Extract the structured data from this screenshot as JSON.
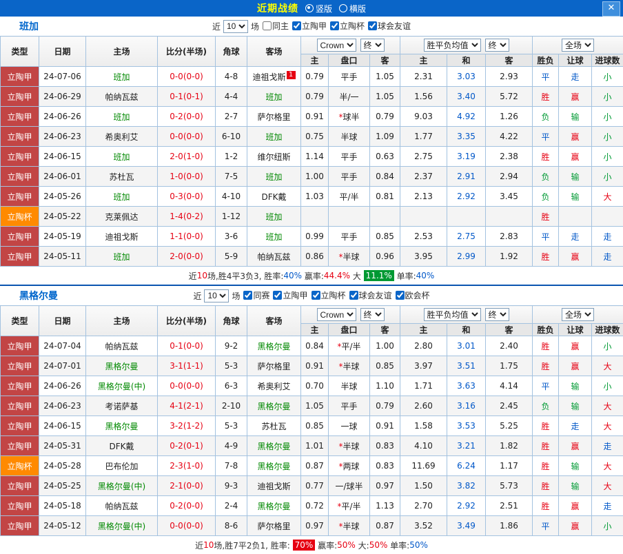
{
  "topbar": {
    "title": "近期战绩",
    "vertical_label": "竖版",
    "horizontal_label": "横版",
    "close": "✕"
  },
  "colors": {
    "red": "#e60012",
    "green": "#009933",
    "blue": "#0057c8",
    "league_red": "#c24545",
    "league_orange": "#ff8a00",
    "topbar_blue": "#0a65c8",
    "team_green": "#008800",
    "title_yellow": "#ffff00",
    "link_blue": "#0066cc"
  },
  "table_header": {
    "type": "类型",
    "date": "日期",
    "home": "主场",
    "score": "比分(半场)",
    "corner": "角球",
    "away": "客场",
    "odds_source": "Crown",
    "final": "终",
    "avg_label": "胜平负均值",
    "final2": "终",
    "scope": "全场",
    "home_odds": "主",
    "handicap": "盘口",
    "away_odds": "客",
    "home_eu": "主",
    "draw_eu": "和",
    "away_eu": "客",
    "result": "胜负",
    "handicap_result": "让球",
    "goals": "进球数"
  },
  "sections": [
    {
      "team": "班加",
      "filter": {
        "prefix": "近",
        "count": "10",
        "suffix": "场",
        "options": [
          {
            "label": "同主",
            "checked": false
          },
          {
            "label": "立陶甲",
            "checked": true
          },
          {
            "label": "立陶杯",
            "checked": true
          },
          {
            "label": "球会友谊",
            "checked": true
          }
        ]
      },
      "rows": [
        {
          "league": "立陶甲",
          "date": "24-07-06",
          "home": "班加",
          "home_team": true,
          "score": "0-0(0-0)",
          "corner": "4-8",
          "away": "迪祖戈斯",
          "badge": "1",
          "ah": "0.79",
          "hcap": "平手",
          "aa": "1.05",
          "eh": "2.31",
          "ed": "3.03",
          "ea": "2.93",
          "res": "平",
          "res_c": "blue",
          "let": "走",
          "let_c": "blue",
          "goal": "小",
          "goal_c": "green"
        },
        {
          "league": "立陶甲",
          "date": "24-06-29",
          "home": "帕纳瓦兹",
          "score": "0-1(0-1)",
          "corner": "4-4",
          "away": "班加",
          "away_team": true,
          "ah": "0.79",
          "hcap": "半/一",
          "aa": "1.05",
          "eh": "1.56",
          "ed": "3.40",
          "ea": "5.72",
          "res": "胜",
          "res_c": "red",
          "let": "赢",
          "let_c": "red",
          "goal": "小",
          "goal_c": "green"
        },
        {
          "league": "立陶甲",
          "date": "24-06-26",
          "home": "班加",
          "home_team": true,
          "score": "0-2(0-0)",
          "corner": "2-7",
          "away": "萨尔格里",
          "ah": "0.91",
          "hcap": "*球半",
          "aa": "0.79",
          "eh": "9.03",
          "ed": "4.92",
          "ea": "1.26",
          "res": "负",
          "res_c": "green",
          "let": "输",
          "let_c": "green",
          "goal": "小",
          "goal_c": "green"
        },
        {
          "league": "立陶甲",
          "date": "24-06-23",
          "home": "希奥利艾",
          "score": "0-0(0-0)",
          "corner": "6-10",
          "away": "班加",
          "away_team": true,
          "ah": "0.75",
          "hcap": "半球",
          "aa": "1.09",
          "eh": "1.77",
          "ed": "3.35",
          "ea": "4.22",
          "res": "平",
          "res_c": "blue",
          "let": "赢",
          "let_c": "red",
          "goal": "小",
          "goal_c": "green"
        },
        {
          "league": "立陶甲",
          "date": "24-06-15",
          "home": "班加",
          "home_team": true,
          "score": "2-0(1-0)",
          "corner": "1-2",
          "away": "维尔纽斯",
          "ah": "1.14",
          "hcap": "平手",
          "aa": "0.63",
          "eh": "2.75",
          "ed": "3.19",
          "ea": "2.38",
          "res": "胜",
          "res_c": "red",
          "let": "赢",
          "let_c": "red",
          "goal": "小",
          "goal_c": "green"
        },
        {
          "league": "立陶甲",
          "date": "24-06-01",
          "home": "苏杜瓦",
          "score": "1-0(0-0)",
          "corner": "7-5",
          "away": "班加",
          "away_team": true,
          "ah": "1.00",
          "hcap": "平手",
          "aa": "0.84",
          "eh": "2.37",
          "ed": "2.91",
          "ea": "2.94",
          "res": "负",
          "res_c": "green",
          "let": "输",
          "let_c": "green",
          "goal": "小",
          "goal_c": "green"
        },
        {
          "league": "立陶甲",
          "date": "24-05-26",
          "home": "班加",
          "home_team": true,
          "score": "0-3(0-0)",
          "corner": "4-10",
          "away": "DFK戴",
          "ah": "1.03",
          "hcap": "平/半",
          "aa": "0.81",
          "eh": "2.13",
          "ed": "2.92",
          "ea": "3.45",
          "res": "负",
          "res_c": "green",
          "let": "输",
          "let_c": "green",
          "goal": "大",
          "goal_c": "red"
        },
        {
          "league": "立陶杯",
          "league_color": "orange",
          "date": "24-05-22",
          "home": "克莱佩达",
          "score": "1-4(0-2)",
          "corner": "1-12",
          "away": "班加",
          "away_team": true,
          "ah": "",
          "hcap": "",
          "aa": "",
          "eh": "",
          "ed": "",
          "ea": "",
          "res": "胜",
          "res_c": "red",
          "let": "",
          "goal": ""
        },
        {
          "league": "立陶甲",
          "date": "24-05-19",
          "home": "迪祖戈斯",
          "score": "1-1(0-0)",
          "corner": "3-6",
          "away": "班加",
          "away_team": true,
          "ah": "0.99",
          "hcap": "平手",
          "aa": "0.85",
          "eh": "2.53",
          "ed": "2.75",
          "ea": "2.83",
          "res": "平",
          "res_c": "blue",
          "let": "走",
          "let_c": "blue",
          "goal": "走",
          "goal_c": "blue"
        },
        {
          "league": "立陶甲",
          "date": "24-05-11",
          "home": "班加",
          "home_team": true,
          "score": "2-0(0-0)",
          "corner": "5-9",
          "away": "帕纳瓦兹",
          "ah": "0.86",
          "hcap": "*半球",
          "aa": "0.96",
          "eh": "3.95",
          "ed": "2.99",
          "ea": "1.92",
          "res": "胜",
          "res_c": "red",
          "let": "赢",
          "let_c": "red",
          "goal": "走",
          "goal_c": "blue"
        }
      ],
      "summary": [
        {
          "t": "近"
        },
        {
          "t": "10",
          "c": "red"
        },
        {
          "t": "场,胜4平3负3, 胜率:"
        },
        {
          "t": "40%",
          "c": "blue"
        },
        {
          "t": " 赢率:"
        },
        {
          "t": "44.4%",
          "c": "red"
        },
        {
          "t": " 大 "
        },
        {
          "t": "11.1%",
          "bg": "green"
        },
        {
          "t": " 单率:"
        },
        {
          "t": "40%",
          "c": "blue"
        }
      ]
    },
    {
      "team": "黑格尔曼",
      "filter": {
        "prefix": "近",
        "count": "10",
        "suffix": "场",
        "options": [
          {
            "label": "同赛",
            "checked": true
          },
          {
            "label": "立陶甲",
            "checked": true
          },
          {
            "label": "立陶杯",
            "checked": true
          },
          {
            "label": "球会友谊",
            "checked": true
          },
          {
            "label": "欧会杯",
            "checked": true
          }
        ]
      },
      "rows": [
        {
          "league": "立陶甲",
          "date": "24-07-04",
          "home": "帕纳瓦兹",
          "score": "0-1(0-0)",
          "corner": "9-2",
          "away": "黑格尔曼",
          "away_team": true,
          "ah": "0.84",
          "hcap": "*平/半",
          "aa": "1.00",
          "eh": "2.80",
          "ed": "3.01",
          "ea": "2.40",
          "res": "胜",
          "res_c": "red",
          "let": "赢",
          "let_c": "red",
          "goal": "小",
          "goal_c": "green"
        },
        {
          "league": "立陶甲",
          "date": "24-07-01",
          "home": "黑格尔曼",
          "home_team": true,
          "score": "3-1(1-1)",
          "corner": "5-3",
          "away": "萨尔格里",
          "ah": "0.91",
          "hcap": "*半球",
          "aa": "0.85",
          "eh": "3.97",
          "ed": "3.51",
          "ea": "1.75",
          "res": "胜",
          "res_c": "red",
          "let": "赢",
          "let_c": "red",
          "goal": "大",
          "goal_c": "red"
        },
        {
          "league": "立陶甲",
          "date": "24-06-26",
          "home": "黑格尔曼(中)",
          "home_team": true,
          "score": "0-0(0-0)",
          "corner": "6-3",
          "away": "希奥利艾",
          "ah": "0.70",
          "hcap": "半球",
          "aa": "1.10",
          "eh": "1.71",
          "ed": "3.63",
          "ea": "4.14",
          "res": "平",
          "res_c": "blue",
          "let": "输",
          "let_c": "green",
          "goal": "小",
          "goal_c": "green"
        },
        {
          "league": "立陶甲",
          "date": "24-06-23",
          "home": "考诺萨基",
          "score": "4-1(2-1)",
          "corner": "2-10",
          "away": "黑格尔曼",
          "away_team": true,
          "ah": "1.05",
          "hcap": "平手",
          "aa": "0.79",
          "eh": "2.60",
          "ed": "3.16",
          "ea": "2.45",
          "res": "负",
          "res_c": "green",
          "let": "输",
          "let_c": "green",
          "goal": "大",
          "goal_c": "red"
        },
        {
          "league": "立陶甲",
          "date": "24-06-15",
          "home": "黑格尔曼",
          "home_team": true,
          "score": "3-2(1-2)",
          "corner": "5-3",
          "away": "苏杜瓦",
          "ah": "0.85",
          "hcap": "一球",
          "aa": "0.91",
          "eh": "1.58",
          "ed": "3.53",
          "ea": "5.25",
          "res": "胜",
          "res_c": "red",
          "let": "走",
          "let_c": "blue",
          "goal": "大",
          "goal_c": "red"
        },
        {
          "league": "立陶甲",
          "date": "24-05-31",
          "home": "DFK戴",
          "score": "0-2(0-1)",
          "corner": "4-9",
          "away": "黑格尔曼",
          "away_team": true,
          "ah": "1.01",
          "hcap": "*半球",
          "aa": "0.83",
          "eh": "4.10",
          "ed": "3.21",
          "ea": "1.82",
          "res": "胜",
          "res_c": "red",
          "let": "赢",
          "let_c": "red",
          "goal": "走",
          "goal_c": "blue"
        },
        {
          "league": "立陶杯",
          "league_color": "orange",
          "date": "24-05-28",
          "home": "巴布伦加",
          "score": "2-3(1-0)",
          "corner": "7-8",
          "away": "黑格尔曼",
          "away_team": true,
          "ah": "0.87",
          "hcap": "*两球",
          "aa": "0.83",
          "eh": "11.69",
          "ed": "6.24",
          "ea": "1.17",
          "res": "胜",
          "res_c": "red",
          "let": "输",
          "let_c": "green",
          "goal": "大",
          "goal_c": "red"
        },
        {
          "league": "立陶甲",
          "date": "24-05-25",
          "home": "黑格尔曼(中)",
          "home_team": true,
          "score": "2-1(0-0)",
          "corner": "9-3",
          "away": "迪祖戈斯",
          "ah": "0.77",
          "hcap": "一/球半",
          "aa": "0.97",
          "eh": "1.50",
          "ed": "3.82",
          "ea": "5.73",
          "res": "胜",
          "res_c": "red",
          "let": "输",
          "let_c": "green",
          "goal": "大",
          "goal_c": "red"
        },
        {
          "league": "立陶甲",
          "date": "24-05-18",
          "home": "帕纳瓦兹",
          "score": "0-2(0-0)",
          "corner": "2-4",
          "away": "黑格尔曼",
          "away_team": true,
          "ah": "0.72",
          "hcap": "*平/半",
          "aa": "1.13",
          "eh": "2.70",
          "ed": "2.92",
          "ea": "2.51",
          "res": "胜",
          "res_c": "red",
          "let": "赢",
          "let_c": "red",
          "goal": "走",
          "goal_c": "blue"
        },
        {
          "league": "立陶甲",
          "date": "24-05-12",
          "home": "黑格尔曼(中)",
          "home_team": true,
          "score": "0-0(0-0)",
          "corner": "8-6",
          "away": "萨尔格里",
          "ah": "0.97",
          "hcap": "*半球",
          "aa": "0.87",
          "eh": "3.52",
          "ed": "3.49",
          "ea": "1.86",
          "res": "平",
          "res_c": "blue",
          "let": "赢",
          "let_c": "red",
          "goal": "小",
          "goal_c": "green"
        }
      ],
      "summary": [
        {
          "t": "近"
        },
        {
          "t": "10",
          "c": "red"
        },
        {
          "t": "场,胜7平2负1, 胜率: "
        },
        {
          "t": "70%",
          "bg": "red"
        },
        {
          "t": " 赢率:"
        },
        {
          "t": "50%",
          "c": "red"
        },
        {
          "t": " 大:"
        },
        {
          "t": "50%",
          "c": "red"
        },
        {
          "t": " 单率:"
        },
        {
          "t": "50%",
          "c": "blue"
        }
      ]
    }
  ]
}
